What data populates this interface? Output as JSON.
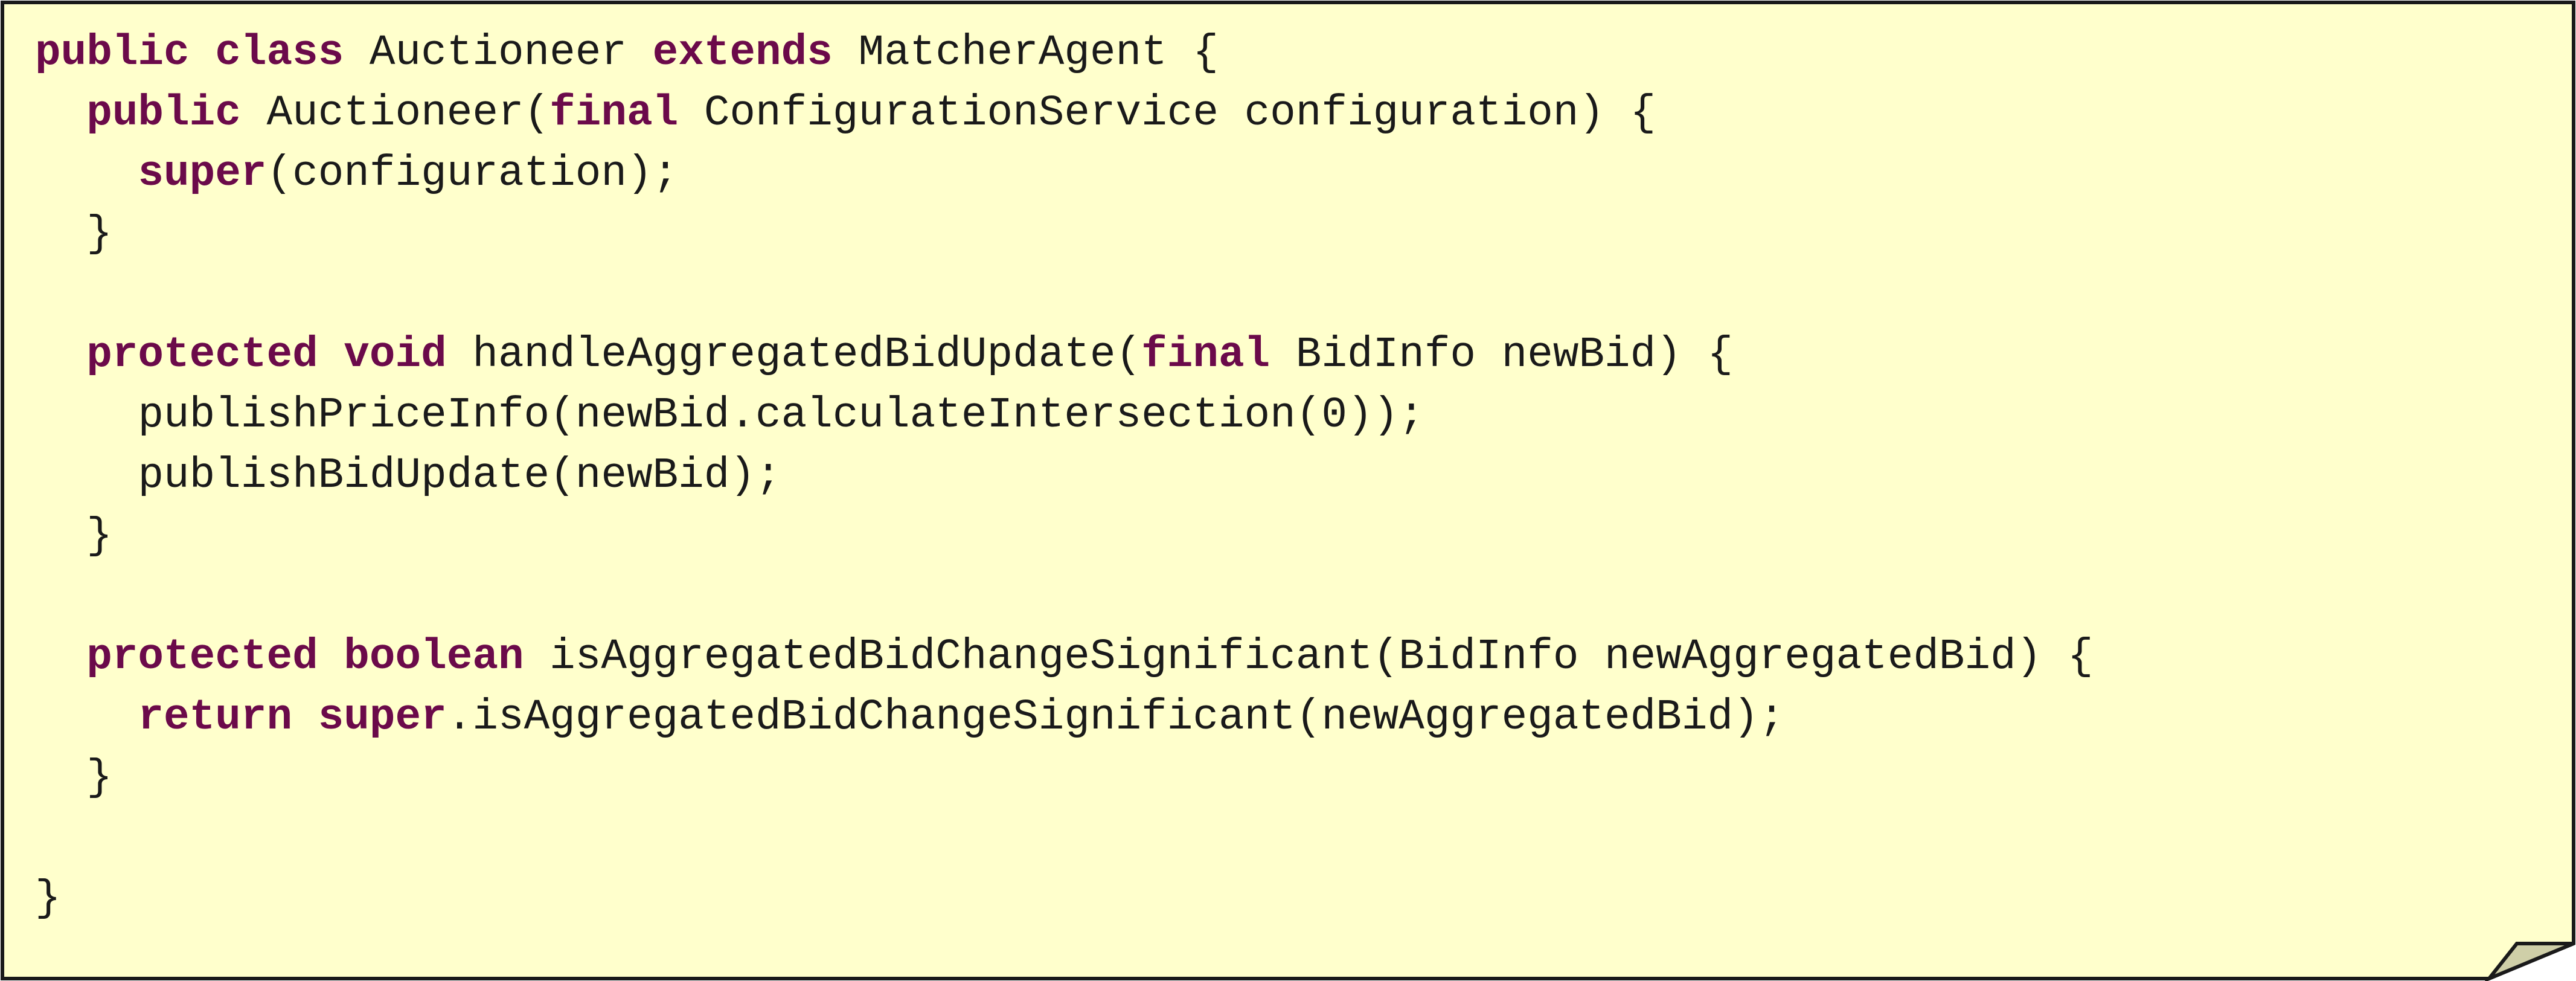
{
  "colors": {
    "background": "#ffffcc",
    "border": "#1a1a1a",
    "keyword": "#6b0a4a",
    "text": "#1a1a1a",
    "fold": "#cfcfa8"
  },
  "icons": {
    "corner": "folded-corner-icon"
  },
  "code": {
    "lines": [
      {
        "indent": 0,
        "tokens": [
          {
            "t": "public",
            "kw": true
          },
          {
            "t": " "
          },
          {
            "t": "class",
            "kw": true
          },
          {
            "t": " Auctioneer "
          },
          {
            "t": "extends",
            "kw": true
          },
          {
            "t": " MatcherAgent {"
          }
        ]
      },
      {
        "indent": 1,
        "tokens": [
          {
            "t": "public",
            "kw": true
          },
          {
            "t": " Auctioneer("
          },
          {
            "t": "final",
            "kw": true
          },
          {
            "t": " ConfigurationService configuration) {"
          }
        ]
      },
      {
        "indent": 2,
        "tokens": [
          {
            "t": "super",
            "kw": true
          },
          {
            "t": "(configuration);"
          }
        ]
      },
      {
        "indent": 1,
        "tokens": [
          {
            "t": "}"
          }
        ]
      },
      {
        "indent": 0,
        "tokens": []
      },
      {
        "indent": 1,
        "tokens": [
          {
            "t": "protected",
            "kw": true
          },
          {
            "t": " "
          },
          {
            "t": "void",
            "kw": true
          },
          {
            "t": " handleAggregatedBidUpdate("
          },
          {
            "t": "final",
            "kw": true
          },
          {
            "t": " BidInfo newBid) {"
          }
        ]
      },
      {
        "indent": 2,
        "tokens": [
          {
            "t": "publishPriceInfo(newBid.calculateIntersection(0));"
          }
        ]
      },
      {
        "indent": 2,
        "tokens": [
          {
            "t": "publishBidUpdate(newBid);"
          }
        ]
      },
      {
        "indent": 1,
        "tokens": [
          {
            "t": "}"
          }
        ]
      },
      {
        "indent": 0,
        "tokens": []
      },
      {
        "indent": 1,
        "tokens": [
          {
            "t": "protected",
            "kw": true
          },
          {
            "t": " "
          },
          {
            "t": "boolean",
            "kw": true
          },
          {
            "t": " isAggregatedBidChangeSignificant(BidInfo newAggregatedBid) {"
          }
        ]
      },
      {
        "indent": 2,
        "tokens": [
          {
            "t": "return",
            "kw": true
          },
          {
            "t": " "
          },
          {
            "t": "super",
            "kw": true
          },
          {
            "t": ".isAggregatedBidChangeSignificant(newAggregatedBid);"
          }
        ]
      },
      {
        "indent": 1,
        "tokens": [
          {
            "t": "}"
          }
        ]
      },
      {
        "indent": 0,
        "tokens": []
      },
      {
        "indent": 0,
        "tokens": [
          {
            "t": "}"
          }
        ]
      }
    ]
  }
}
